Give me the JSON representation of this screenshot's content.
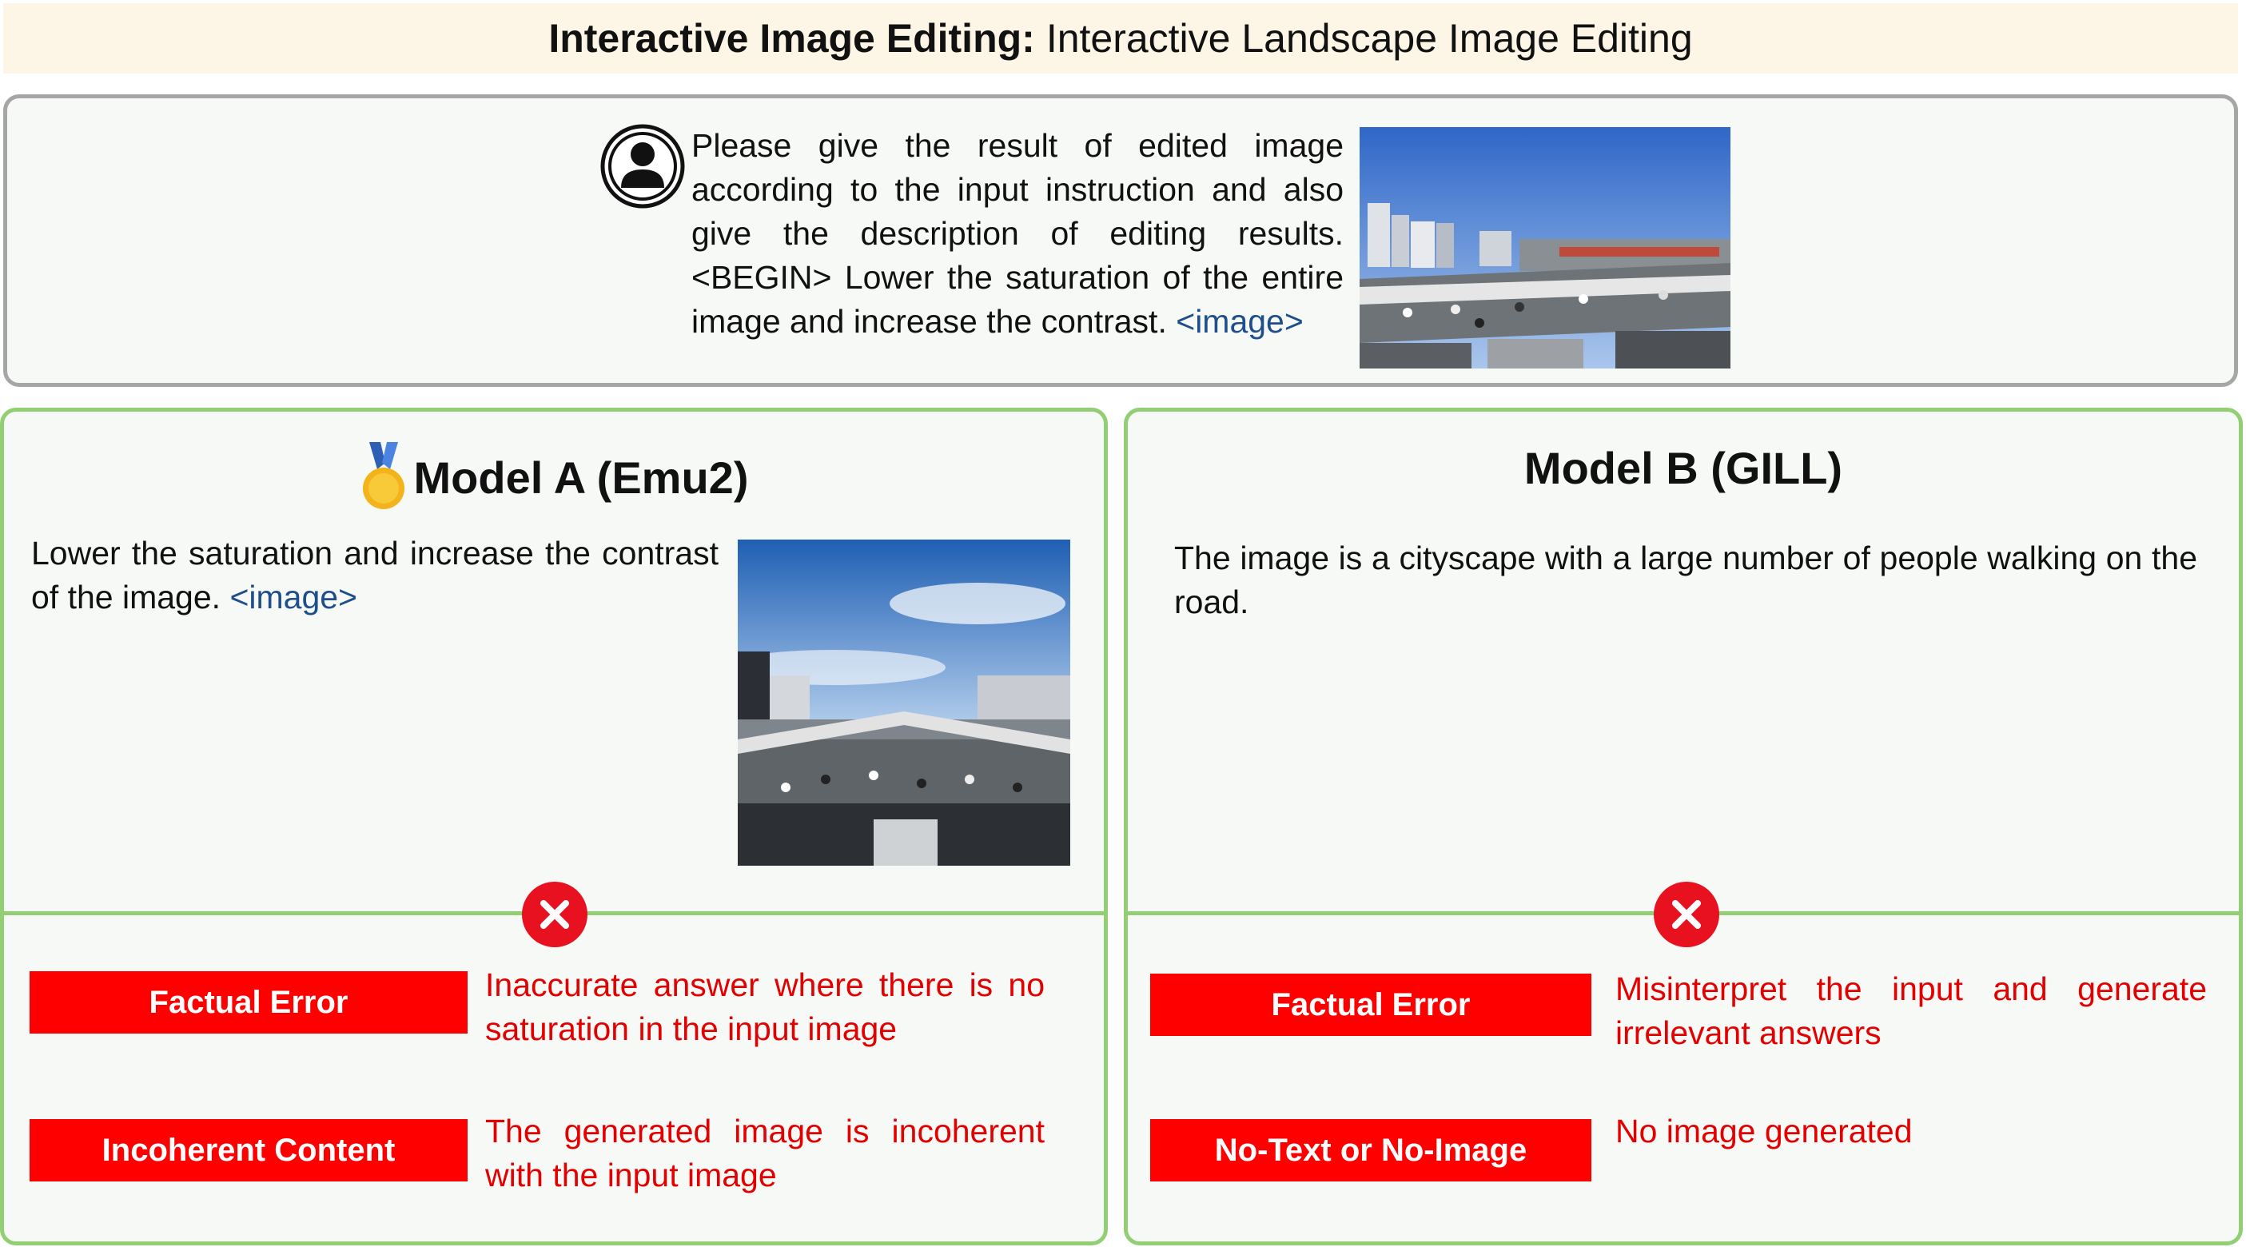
{
  "header": {
    "title_bold": "Interactive Image Editing:",
    "title_rest": "Interactive Landscape Image Editing"
  },
  "prompt": {
    "text": "Please give the result of edited image according to the input instruction and also give the description of editing results. <BEGIN> Lower the saturation of the entire image and increase the contrast.",
    "image_token": "<image>"
  },
  "model_a": {
    "title": "Model A (Emu2)",
    "response_text": "Lower the saturation and increase the contrast of the image.",
    "image_token": "<image>",
    "errors": [
      {
        "tag": "Factual Error",
        "description": "Inaccurate answer where there is no saturation in the input image"
      },
      {
        "tag": "Incoherent Content",
        "description": "The generated image is incoherent with the input image"
      }
    ]
  },
  "model_b": {
    "title": "Model B (GILL)",
    "response_text": "The image is a cityscape with a large number of people walking on the road.",
    "errors": [
      {
        "tag": "Factual Error",
        "description": "Misinterpret the input and generate irrelevant answers"
      },
      {
        "tag": "No-Text or No-Image",
        "description": "No image generated"
      }
    ]
  },
  "colors": {
    "panel_border": "#92cf74",
    "error_red": "#ff0000",
    "title_bg": "#fdf6e6",
    "image_token": "#1e4e8c"
  },
  "icons": [
    "user-avatar-icon",
    "medal-icon",
    "x-mark-icon"
  ]
}
